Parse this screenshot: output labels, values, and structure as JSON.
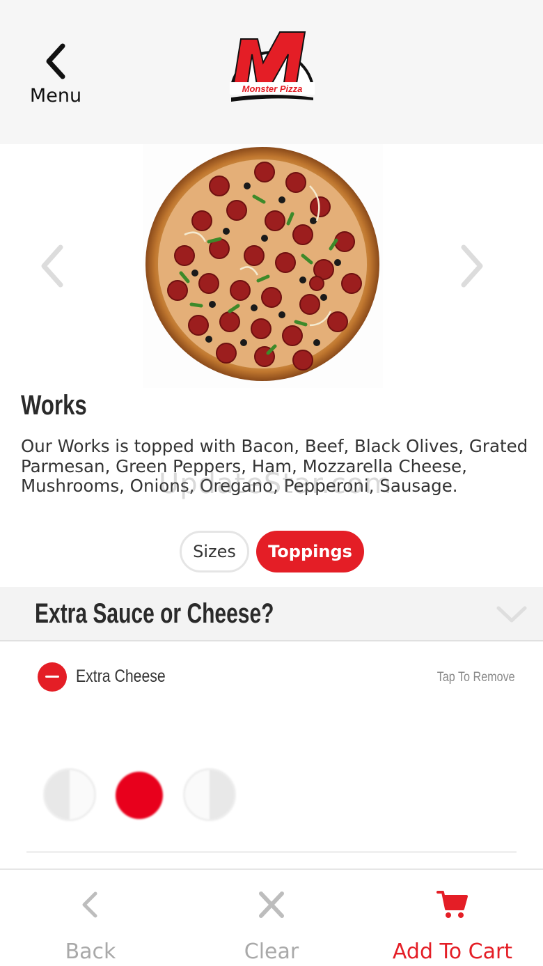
{
  "header": {
    "menu_label": "Menu",
    "logo_text": "Monster Pizza",
    "logo_letter": "M"
  },
  "product": {
    "name": "Works",
    "description": "Our Works is topped with Bacon, Beef, Black Olives, Grated Parmesan, Green Peppers, Ham, Mozzarella Cheese, Mushrooms, Onions, Oregano, Pepperoni, Sausage."
  },
  "watermark": "UpdateStar.com",
  "tabs": {
    "sizes_label": "Sizes",
    "toppings_label": "Toppings",
    "active": "Toppings"
  },
  "section": {
    "title": "Extra Sauce or Cheese?",
    "items": [
      {
        "name": "Extra Cheese",
        "action_label": "Tap To Remove",
        "portion": "whole"
      }
    ]
  },
  "bottom_bar": {
    "back_label": "Back",
    "clear_label": "Clear",
    "cart_label": "Add To Cart"
  },
  "colors": {
    "accent": "#e41e26",
    "header_bg": "#f6f6f6",
    "muted": "#a9a9a9"
  },
  "icons": {
    "menu": "chevron-left-icon",
    "gallery_prev": "chevron-left-icon",
    "gallery_next": "chevron-right-icon",
    "section_toggle": "chevron-down-icon",
    "remove": "minus-circle-icon",
    "back": "chevron-left-icon",
    "clear": "close-icon",
    "cart": "cart-icon"
  }
}
